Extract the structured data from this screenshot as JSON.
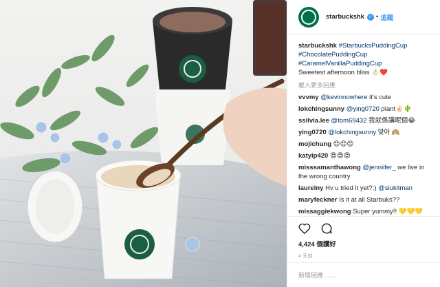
{
  "header": {
    "username": "starbuckshk",
    "dot": "•",
    "follow_label": "追蹤",
    "verified_glyph": "✓"
  },
  "caption": {
    "username": "starbuckshk",
    "tags": [
      "#StarbucksPuddingCup",
      "#ChocolatePuddingCup",
      "#CaramelVanillaPuddingCup"
    ],
    "text": "Sweetest afternoon bliss 👌🏻❤️"
  },
  "load_more": "載入更多回應",
  "comments": [
    {
      "user": "vvvmy",
      "mention": "@kevinnowhere",
      "text": " it's cute"
    },
    {
      "user": "lokchingsunny",
      "mention": "@ying0720",
      "text": " plant✌🏻🌵"
    },
    {
      "user": "ssilvia.lee",
      "mention": "@tom69432",
      "text": " 我就係講呢個😂"
    },
    {
      "user": "ying0720",
      "mention": "@lokchingsunny",
      "text": " 맞아 🙉"
    },
    {
      "user": "mojichung",
      "mention": "",
      "text": "😍😍😍"
    },
    {
      "user": "katyip420",
      "mention": "",
      "text": "😍😍😍"
    },
    {
      "user": "misssamanthawong",
      "mention": "@jenniifer_",
      "text": " we live in the wrong country"
    },
    {
      "user": "laurelny",
      "mention": "",
      "text": "Hv u tried it yet?:)",
      "mention2": " @siukitman"
    },
    {
      "user": "maryfeckner",
      "mention": "",
      "text": "Is it at all Starbuks??"
    },
    {
      "user": "missaggiekwong",
      "mention": "",
      "text": "Super yummy!! 💛💛💛💛"
    }
  ],
  "extra_emoji": "💛",
  "likes": "4,424 個讚好",
  "time": "4 天前",
  "add_comment_placeholder": "新增回應……",
  "icons": [
    "heart-icon",
    "comment-icon"
  ],
  "colors": {
    "brand": "#00704a",
    "link": "#3897f0",
    "tag": "#003569"
  }
}
